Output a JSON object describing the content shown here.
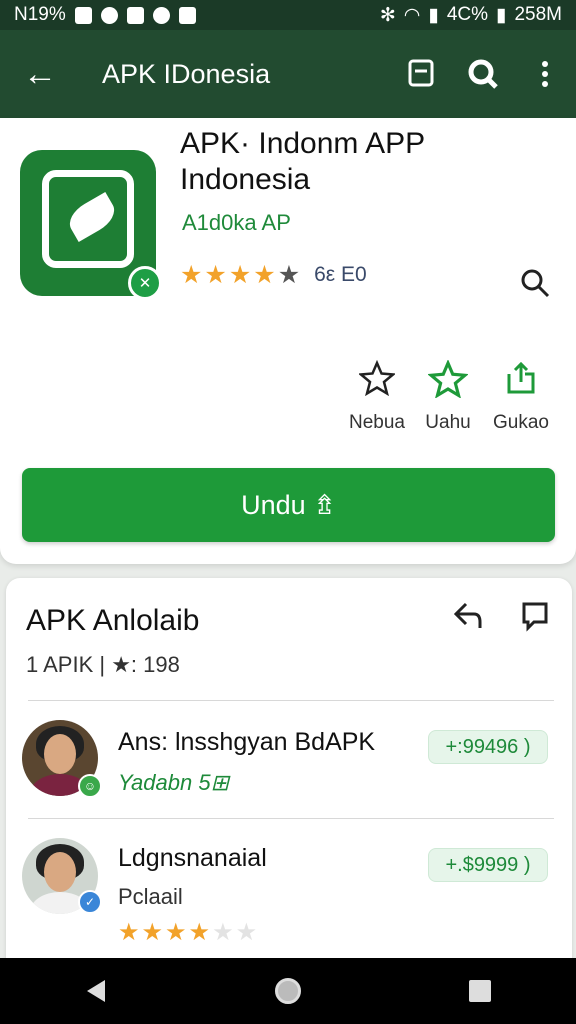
{
  "status_bar": {
    "left_text": "N19%",
    "battery": "4C%",
    "time": "258M"
  },
  "app_bar": {
    "back_icon": "←",
    "title": "APK IDonesia"
  },
  "app": {
    "name": "APK· Indonm APP Indonesia",
    "developer": "A1d0ka AP",
    "rating_text": "6ε Ε0",
    "actions": [
      {
        "label": "Nebua"
      },
      {
        "label": "Uahu"
      },
      {
        "label": "Gukao"
      }
    ],
    "download_label": "Undu ⇯"
  },
  "section": {
    "title": "APK Anlolaib",
    "meta": "1 APIK | ★: 198"
  },
  "items": [
    {
      "name": "Ans: lnsshgyan BdAPK",
      "subtitle": "Yadabn 5⊞",
      "price": "+:99496 )"
    },
    {
      "name": "Ldgnsnanaial",
      "subtitle": "Pclaail",
      "price": "+.$9999 )",
      "rating_stars": 4
    }
  ],
  "colors": {
    "primary": "#224b30",
    "accent": "#1e9a39",
    "star": "#f2a22a"
  }
}
